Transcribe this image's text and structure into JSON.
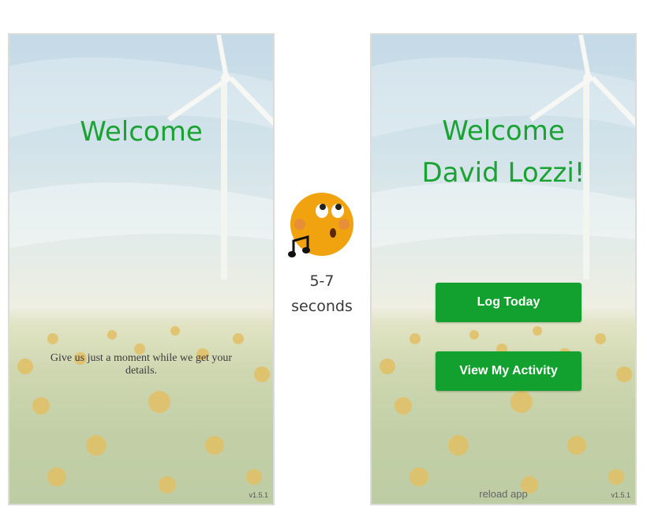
{
  "left_screen": {
    "title": "Welcome",
    "message": "Give us just a moment while we get your details.",
    "version": "v1.5.1"
  },
  "right_screen": {
    "title_line1": "Welcome",
    "title_line2": "David Lozzi!",
    "buttons": [
      "Log Today",
      "View My Activity"
    ],
    "reload_label": "reload app",
    "version": "v1.5.1"
  },
  "transition": {
    "emoji": "whistling-face-icon",
    "duration_line1": "5-7",
    "duration_line2": "seconds"
  },
  "colors": {
    "accent_green": "#1aa332",
    "button_green": "#12a02e",
    "emoji_yellow": "#f0a30f"
  }
}
